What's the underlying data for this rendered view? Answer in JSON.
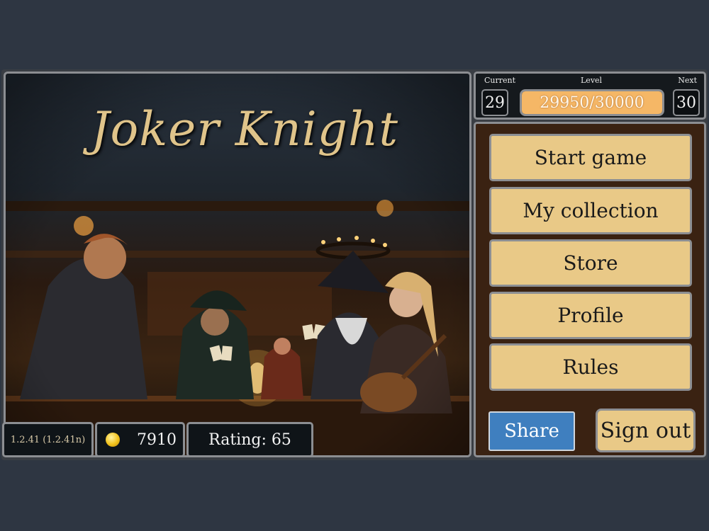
{
  "title": "Joker Knight",
  "level": {
    "current_caption": "Current",
    "level_caption": "Level",
    "next_caption": "Next",
    "current": "29",
    "next": "30",
    "xp_text": "29950/30000",
    "progress_percent": 99.8
  },
  "menu": {
    "start": "Start game",
    "collection": "My collection",
    "store": "Store",
    "profile": "Profile",
    "rules": "Rules",
    "share": "Share",
    "signout": "Sign out"
  },
  "footer": {
    "version": "1.2.41 (1.2.41n)",
    "coins": "7910",
    "rating": "Rating: 65"
  },
  "colors": {
    "background": "#2e3642",
    "button": "#e9c987",
    "share": "#3f7fbf",
    "xp_fill": "#f5b766",
    "menu_panel": "#3a2212"
  },
  "icons": [
    "coin-icon"
  ]
}
